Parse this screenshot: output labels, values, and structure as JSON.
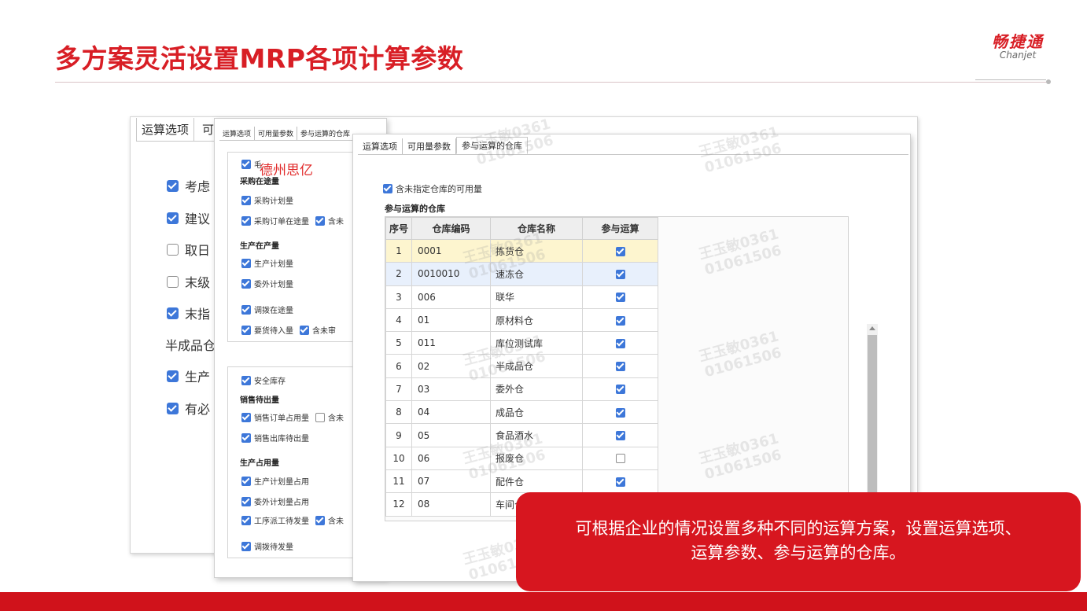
{
  "slide": {
    "title": "多方案灵活设置MRP各项计算参数",
    "logo_cn": "畅捷通",
    "logo_en": "Chanjet"
  },
  "window1": {
    "tabs": [
      "运算选项",
      "可"
    ],
    "options": [
      {
        "label": "考虑",
        "checked": true
      },
      {
        "label": "建议",
        "checked": true
      },
      {
        "label": "取日",
        "checked": false
      },
      {
        "label": "末级",
        "checked": false
      },
      {
        "label": "末指",
        "checked": true
      }
    ],
    "section": "半成品仓",
    "options2": [
      {
        "label": "生产",
        "checked": true
      },
      {
        "label": "有必",
        "checked": true
      }
    ]
  },
  "window2": {
    "tabs": [
      "运算选项",
      "可用量参数",
      "参与运算的仓库"
    ],
    "first_item": "毛",
    "purchase_head": "采购在途量",
    "purchase_items": [
      "采购计划量",
      "采购订单在途量",
      "含未"
    ],
    "production_head": "生产在产量",
    "production_items": [
      "生产计划量",
      "委外计划量"
    ],
    "transfer_items": [
      "调拨在途量",
      "要货待入量",
      "含未审"
    ],
    "safety_stock": "安全库存",
    "sales_head": "销售待出量",
    "sales_items": [
      "销售订单占用量",
      "含未",
      "销售出库待出量"
    ],
    "occupy_head": "生产占用量",
    "occupy_items": [
      "生产计划量占用",
      "委外计划量占用",
      "工序派工待发量",
      "含未"
    ],
    "transfer_out": "调拨待发量"
  },
  "window3": {
    "tabs": [
      "运算选项",
      "可用量参数",
      "参与运算的仓库"
    ],
    "include_unassigned": "含未指定仓库的可用量",
    "section_title": "参与运算的仓库",
    "columns": [
      "序号",
      "仓库编码",
      "仓库名称",
      "参与运算"
    ],
    "rows": [
      {
        "no": "1",
        "code": "0001",
        "name": "拣货仓",
        "checked": true
      },
      {
        "no": "2",
        "code": "0010010",
        "name": "速冻仓",
        "checked": true
      },
      {
        "no": "3",
        "code": "006",
        "name": "联华",
        "checked": true
      },
      {
        "no": "4",
        "code": "01",
        "name": "原材料仓",
        "checked": true
      },
      {
        "no": "5",
        "code": "011",
        "name": "库位测试库",
        "checked": true
      },
      {
        "no": "6",
        "code": "02",
        "name": "半成品仓",
        "checked": true
      },
      {
        "no": "7",
        "code": "03",
        "name": "委外仓",
        "checked": true
      },
      {
        "no": "8",
        "code": "04",
        "name": "成品仓",
        "checked": true
      },
      {
        "no": "9",
        "code": "05",
        "name": "食品酒水",
        "checked": true
      },
      {
        "no": "10",
        "code": "06",
        "name": "报废仓",
        "checked": false
      },
      {
        "no": "11",
        "code": "07",
        "name": "配件仓",
        "checked": true
      },
      {
        "no": "12",
        "code": "08",
        "name": "车间仓",
        "checked": true
      }
    ]
  },
  "overlay_text": "德州思亿",
  "watermark": {
    "name": "王玉敏0361",
    "id": "01061506"
  },
  "callout": {
    "line1": "可根据企业的情况设置多种不同的运算方案，设置运算选项、",
    "line2": "运算参数、参与运算的仓库。"
  },
  "colors": {
    "brand_red": "#d81e25",
    "bar_red": "#d0121b",
    "checkbox_blue": "#3d77d9"
  }
}
